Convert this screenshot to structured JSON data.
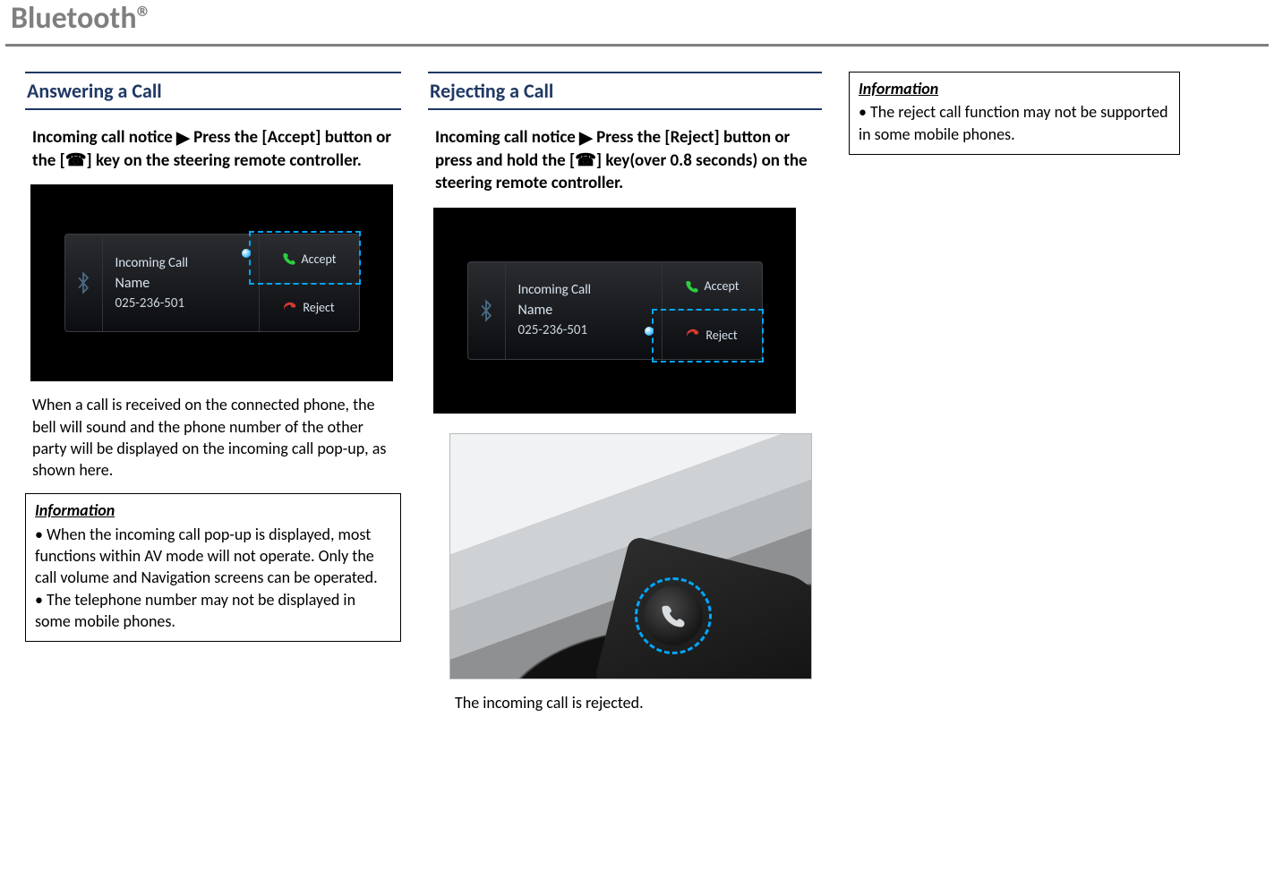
{
  "title": "Bluetooth®",
  "left": {
    "heading": "Answering a Call",
    "instruction_pre": "Incoming call notice",
    "arrow": "▶",
    "instruction_post_a": "Press the [Accept] button or the [",
    "phone_glyph": "☎",
    "instruction_post_b": "] key on the steering remote controller.",
    "shot": {
      "title": "Incoming Call",
      "name": "Name",
      "number": "025-236-501",
      "accept": "Accept",
      "reject": "Reject"
    },
    "after": "When a call is received on the connected phone, the bell will sound and the phone number of the other party will be displayed on the incoming call pop-up, as shown here.",
    "info_title": "Information",
    "info_b1": "• When the incoming call pop-up is displayed, most functions within AV mode will not operate. Only the call volume and Navigation screens can be operated.",
    "info_b2": "• The telephone number may not be displayed in some mobile phones."
  },
  "mid": {
    "heading": "Rejecting a Call",
    "instruction_pre": "Incoming call notice",
    "arrow": "▶",
    "instruction_post_a": "Press the [Reject] button or press and hold the [",
    "phone_glyph": "☎",
    "instruction_post_b": "] key(over 0.8 seconds) on the steering remote controller.",
    "shot": {
      "title": "Incoming Call",
      "name": "Name",
      "number": "025-236-501",
      "accept": "Accept",
      "reject": "Reject"
    },
    "after": "The incoming call is rejected."
  },
  "right": {
    "info_title": "Information",
    "info_b1": "• The reject call function may not be supported in some mobile phones."
  }
}
